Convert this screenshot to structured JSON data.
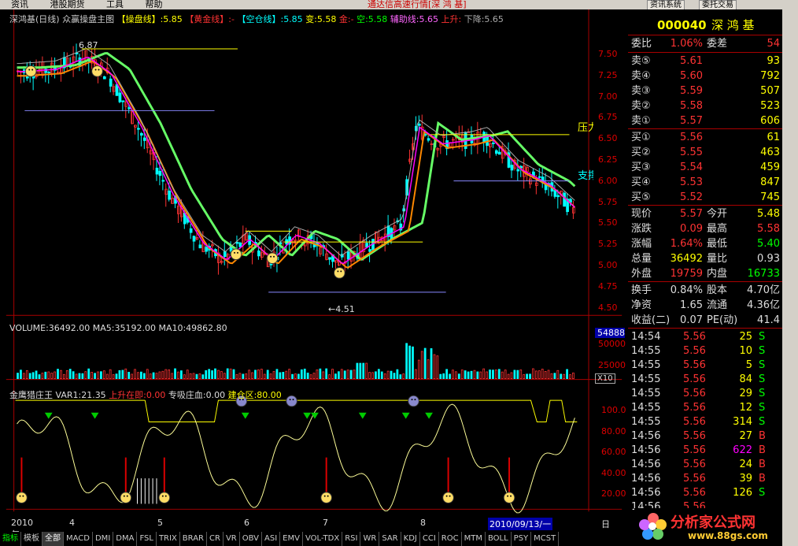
{
  "menu": {
    "items": [
      "资讯",
      "港股期货",
      "工具",
      "帮助"
    ],
    "title": "通达信高速行情[深 鸿 基]",
    "buttons": [
      "资讯系统",
      "委托交易"
    ]
  },
  "main_header": {
    "stock": "深鸿基(日线)",
    "indicator": "众赢操盘主图",
    "op_label": "【操盘线】",
    "op_value": ":5.85",
    "gold_label": "【黄金线】",
    "gold_value": ":-",
    "empty_label": "【空仓线】",
    "empty_value": ":5.85",
    "change_label": "变:5.58",
    "gold2": "金:-",
    "empty2": "空:5.58",
    "aux_label": "辅助线:5.65",
    "up_label": "上升:",
    "down_label": "下降:5.65"
  },
  "price_axis": [
    "7.50",
    "7.25",
    "7.00",
    "6.75",
    "6.50",
    "6.25",
    "6.00",
    "5.75",
    "5.50",
    "5.25",
    "5.00",
    "4.75",
    "4.50"
  ],
  "price_annotations": {
    "high": "6.87",
    "low": "4.51",
    "pressure": "压力",
    "support": "支撑"
  },
  "volume": {
    "header": "VOLUME:36492.00  MA5:35192.00  MA10:49862.80",
    "axis": [
      "54888",
      "50000",
      "25000",
      "X10"
    ]
  },
  "indicator2": {
    "name": "金鹰猎庄王",
    "var": "VAR1:21.35",
    "up": "上升在即:0.00",
    "pressure": "专吸庄血:0.00",
    "build": "建仓区:80.00",
    "axis": [
      "100.0",
      "80.00",
      "60.00",
      "40.00",
      "20.00"
    ]
  },
  "time_axis": {
    "labels": [
      "2010年",
      "4",
      "5",
      "6",
      "7",
      "8"
    ],
    "date": "2010/09/13/一",
    "period": "日线"
  },
  "tabs": [
    "指标",
    "模板",
    "全部",
    "MACD",
    "DMI",
    "DMA",
    "FSL",
    "TRIX",
    "BRAR",
    "CR",
    "VR",
    "OBV",
    "ASI",
    "EMV",
    "VOL-TDX",
    "RSI",
    "WR",
    "SAR",
    "KDJ",
    "CCI",
    "ROC",
    "MTM",
    "BOLL",
    "PSY",
    "MCST"
  ],
  "side": {
    "code": "000040",
    "name": "深 鸿 基",
    "ratio": {
      "label": "委比",
      "value": "1.06%",
      "diff_label": "委差",
      "diff": "54"
    },
    "asks": [
      {
        "label": "卖⑤",
        "price": "5.61",
        "vol": "93"
      },
      {
        "label": "卖④",
        "price": "5.60",
        "vol": "792"
      },
      {
        "label": "卖③",
        "price": "5.59",
        "vol": "507"
      },
      {
        "label": "卖②",
        "price": "5.58",
        "vol": "523"
      },
      {
        "label": "卖①",
        "price": "5.57",
        "vol": "606"
      }
    ],
    "bids": [
      {
        "label": "买①",
        "price": "5.56",
        "vol": "61"
      },
      {
        "label": "买②",
        "price": "5.55",
        "vol": "463"
      },
      {
        "label": "买③",
        "price": "5.54",
        "vol": "459"
      },
      {
        "label": "买④",
        "price": "5.53",
        "vol": "847"
      },
      {
        "label": "买⑤",
        "price": "5.52",
        "vol": "745"
      }
    ],
    "stats": [
      {
        "l1": "现价",
        "v1": "5.57",
        "l2": "今开",
        "v2": "5.48"
      },
      {
        "l1": "涨跌",
        "v1": "0.09",
        "l2": "最高",
        "v2": "5.58"
      },
      {
        "l1": "涨幅",
        "v1": "1.64%",
        "l2": "最低",
        "v2": "5.40"
      },
      {
        "l1": "总量",
        "v1": "36492",
        "l2": "量比",
        "v2": "0.93"
      },
      {
        "l1": "外盘",
        "v1": "19759",
        "l2": "内盘",
        "v2": "16733"
      }
    ],
    "stats2": [
      {
        "l1": "换手",
        "v1": "0.84%",
        "l2": "股本",
        "v2": "4.70亿"
      },
      {
        "l1": "净资",
        "v1": "1.65",
        "l2": "流通",
        "v2": "4.36亿"
      },
      {
        "l1": "收益(二)",
        "v1": "0.07",
        "l2": "PE(动)",
        "v2": "41.4"
      }
    ],
    "ticks": [
      {
        "t": "14:54",
        "p": "5.56",
        "v": "25",
        "s": "S"
      },
      {
        "t": "14:55",
        "p": "5.56",
        "v": "10",
        "s": "S"
      },
      {
        "t": "14:55",
        "p": "5.56",
        "v": "5",
        "s": "S"
      },
      {
        "t": "14:55",
        "p": "5.56",
        "v": "84",
        "s": "S"
      },
      {
        "t": "14:55",
        "p": "5.56",
        "v": "29",
        "s": "S"
      },
      {
        "t": "14:55",
        "p": "5.56",
        "v": "12",
        "s": "S"
      },
      {
        "t": "14:55",
        "p": "5.56",
        "v": "314",
        "s": "S"
      },
      {
        "t": "14:56",
        "p": "5.56",
        "v": "27",
        "s": "B"
      },
      {
        "t": "14:56",
        "p": "5.56",
        "v": "622",
        "s": "B"
      },
      {
        "t": "14:56",
        "p": "5.56",
        "v": "24",
        "s": "B"
      },
      {
        "t": "14:56",
        "p": "5.56",
        "v": "39",
        "s": "B"
      },
      {
        "t": "14:56",
        "p": "5.56",
        "v": "126",
        "s": "S"
      },
      {
        "t": "14:56",
        "p": "5.56",
        "v": "",
        "s": ""
      }
    ]
  },
  "logo": {
    "text": "分析家公式网",
    "url": "www.88gs.com"
  }
}
